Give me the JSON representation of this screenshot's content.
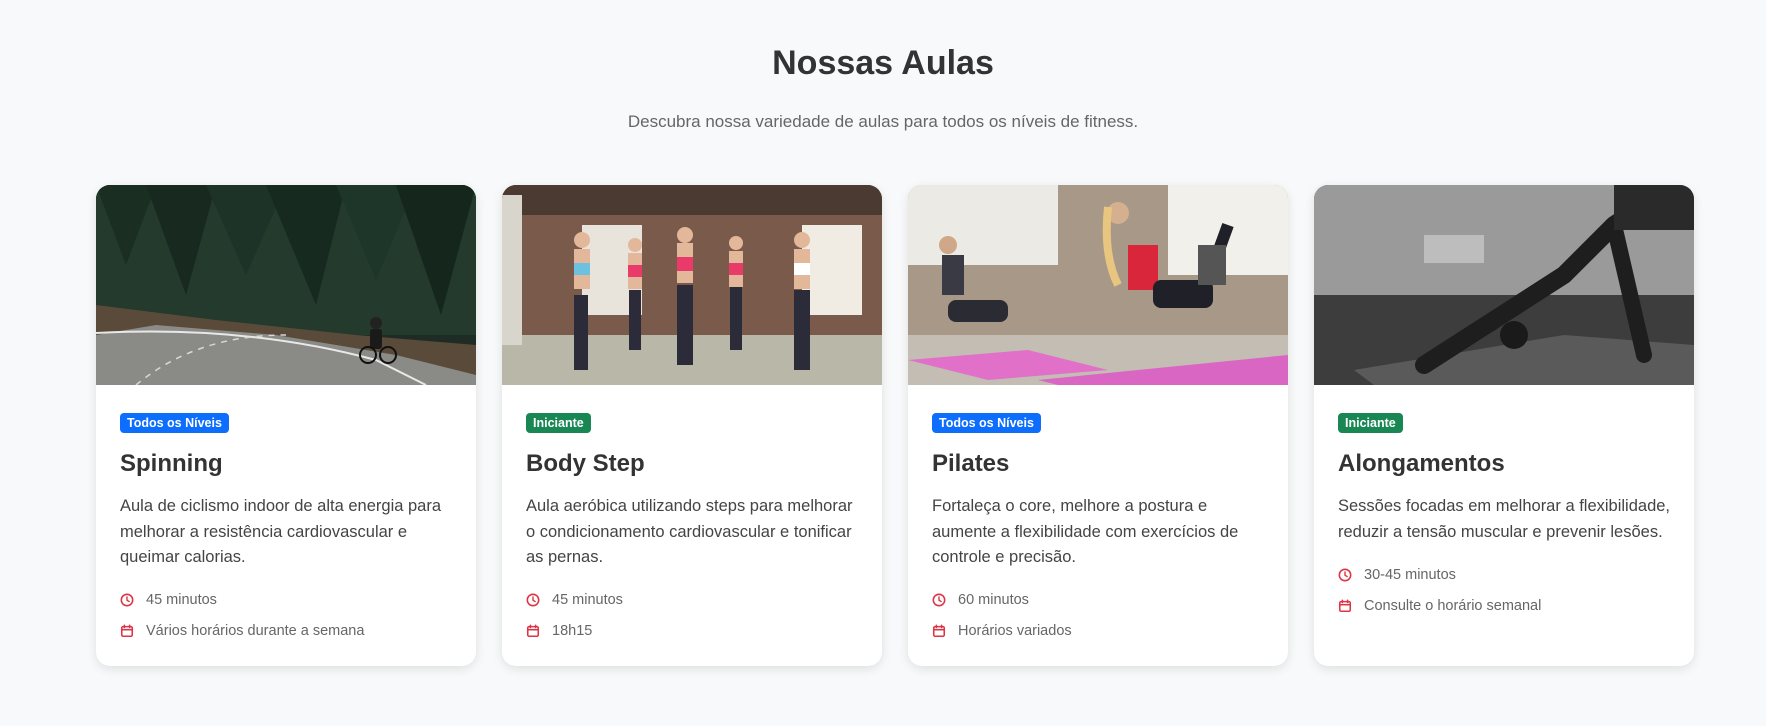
{
  "header": {
    "title": "Nossas Aulas",
    "subtitle": "Descubra nossa variedade de aulas para todos os níveis de fitness."
  },
  "colors": {
    "level_all": "#0d6efd",
    "level_beginner": "#198754",
    "icon": "#dc3545"
  },
  "cards": [
    {
      "image": "cyclist-on-forest-road",
      "badge": "Todos os Níveis",
      "title": "Spinning",
      "description": "Aula de ciclismo indoor de alta energia para melhorar a resistência cardiovascular e queimar calorias.",
      "duration": "45 minutos",
      "schedule": "Vários horários durante a semana"
    },
    {
      "image": "women-aerobics-dumbbells",
      "badge": "Iniciante",
      "title": "Body Step",
      "description": "Aula aeróbica utilizando steps para melhorar o condicionamento cardiovascular e tonificar as pernas.",
      "duration": "45 minutos",
      "schedule": "18h15"
    },
    {
      "image": "women-pilates-mats",
      "badge": "Todos os Níveis",
      "title": "Pilates",
      "description": "Fortaleça o core, melhore a postura e aumente a flexibilidade com exercícios de controle e precisão.",
      "duration": "60 minutos",
      "schedule": "Horários variados"
    },
    {
      "image": "downward-dog-stretch",
      "badge": "Iniciante",
      "title": "Alongamentos",
      "description": "Sessões focadas em melhorar a flexibilidade, reduzir a tensão muscular e prevenir lesões.",
      "duration": "30-45 minutos",
      "schedule": "Consulte o horário semanal"
    }
  ]
}
